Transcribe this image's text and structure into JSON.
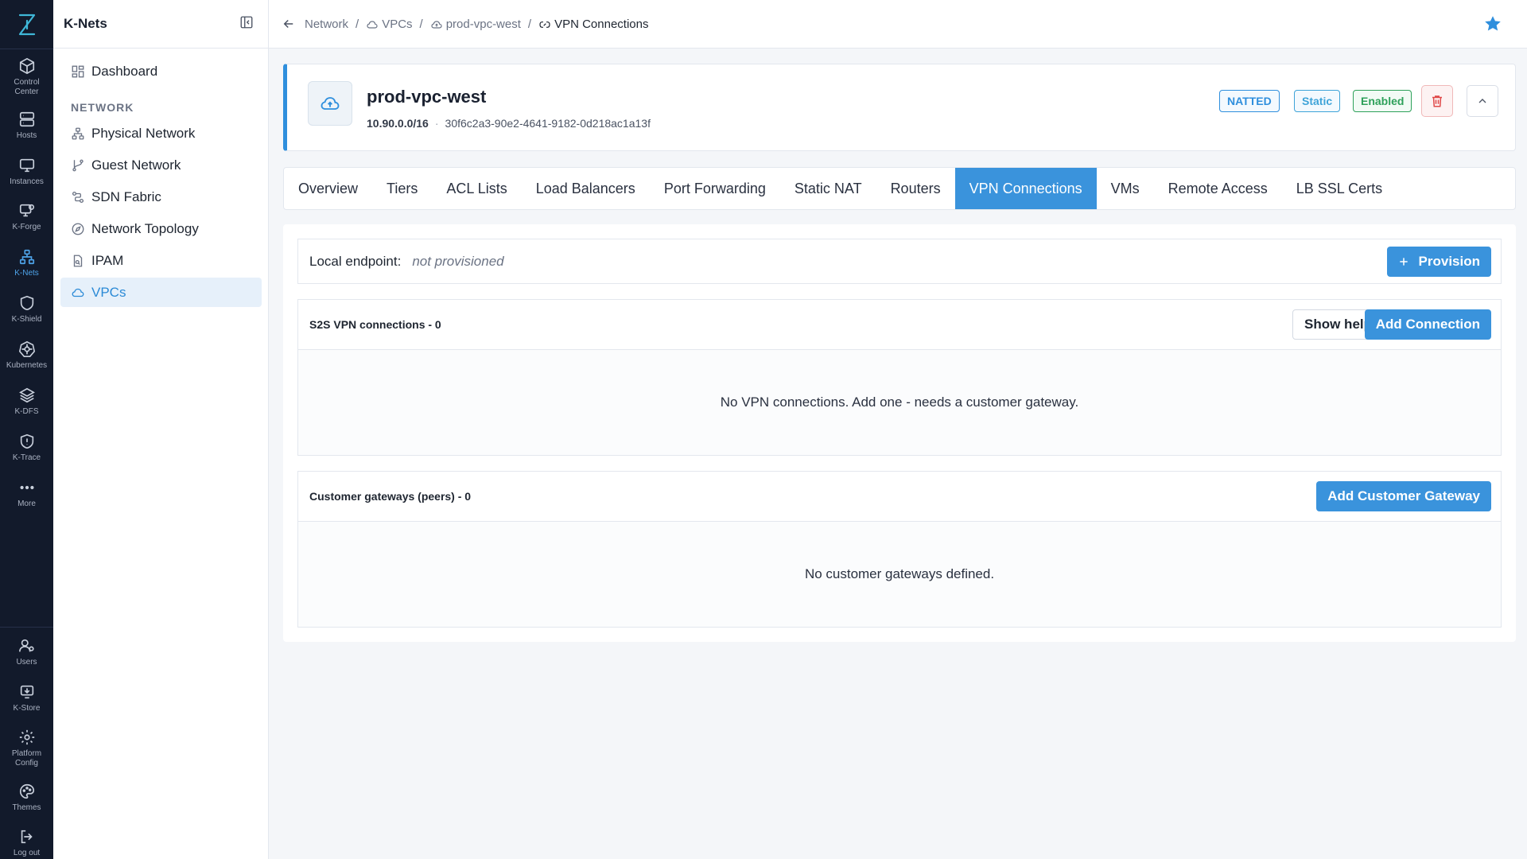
{
  "rail": {
    "items": [
      {
        "label": "Control Center",
        "icon": "cube-icon"
      },
      {
        "label": "Hosts",
        "icon": "server-icon"
      },
      {
        "label": "Instances",
        "icon": "monitor-icon"
      },
      {
        "label": "K-Forge",
        "icon": "forge-icon"
      },
      {
        "label": "K-Nets",
        "icon": "network-icon",
        "active": true
      },
      {
        "label": "K-Shield",
        "icon": "shield-icon"
      },
      {
        "label": "Kubernetes",
        "icon": "helm-icon"
      },
      {
        "label": "K-DFS",
        "icon": "layers-icon"
      },
      {
        "label": "K-Trace",
        "icon": "trace-icon"
      },
      {
        "label": "More",
        "icon": "more-icon"
      }
    ],
    "bottom_items": [
      {
        "label": "Users",
        "icon": "users-icon"
      },
      {
        "label": "K-Store",
        "icon": "store-icon"
      },
      {
        "label": "Platform Config",
        "icon": "gear-icon"
      },
      {
        "label": "Themes",
        "icon": "palette-icon"
      },
      {
        "label": "Log out",
        "icon": "logout-icon"
      }
    ]
  },
  "sidebar": {
    "title": "K-Nets",
    "dashboard": "Dashboard",
    "section": "NETWORK",
    "items": [
      {
        "label": "Physical Network"
      },
      {
        "label": "Guest Network"
      },
      {
        "label": "SDN Fabric"
      },
      {
        "label": "Network Topology"
      },
      {
        "label": "IPAM"
      },
      {
        "label": "VPCs",
        "active": true
      }
    ]
  },
  "breadcrumb": {
    "items": [
      "Network",
      "VPCs",
      "prod-vpc-west",
      "VPN Connections"
    ]
  },
  "vpc": {
    "name": "prod-vpc-west",
    "cidr": "10.90.0.0/16",
    "id": "30f6c2a3-90e2-4641-9182-0d218ac1a13f",
    "badges": [
      "NATTED",
      "Static",
      "Enabled"
    ]
  },
  "tabs": [
    "Overview",
    "Tiers",
    "ACL Lists",
    "Load Balancers",
    "Port Forwarding",
    "Static NAT",
    "Routers",
    "VPN Connections",
    "VMs",
    "Remote Access",
    "LB SSL Certs"
  ],
  "active_tab": "VPN Connections",
  "vpn": {
    "endpoint_label": "Local endpoint:",
    "endpoint_value": "not provisioned",
    "provision_label": "Provision",
    "s2s_title": "S2S VPN connections - 0",
    "show_help_label": "Show help",
    "add_connection_label": "Add Connection",
    "s2s_empty": "No VPN connections. Add one - needs a customer gateway.",
    "cgw_title": "Customer gateways (peers) - 0",
    "add_cgw_label": "Add Customer Gateway",
    "cgw_empty": "No customer gateways defined."
  },
  "colors": {
    "accent": "#3a93dc",
    "rail_bg": "#121a2b",
    "danger": "#e04848",
    "success": "#2ea15a",
    "star": "#2f8fdd"
  }
}
